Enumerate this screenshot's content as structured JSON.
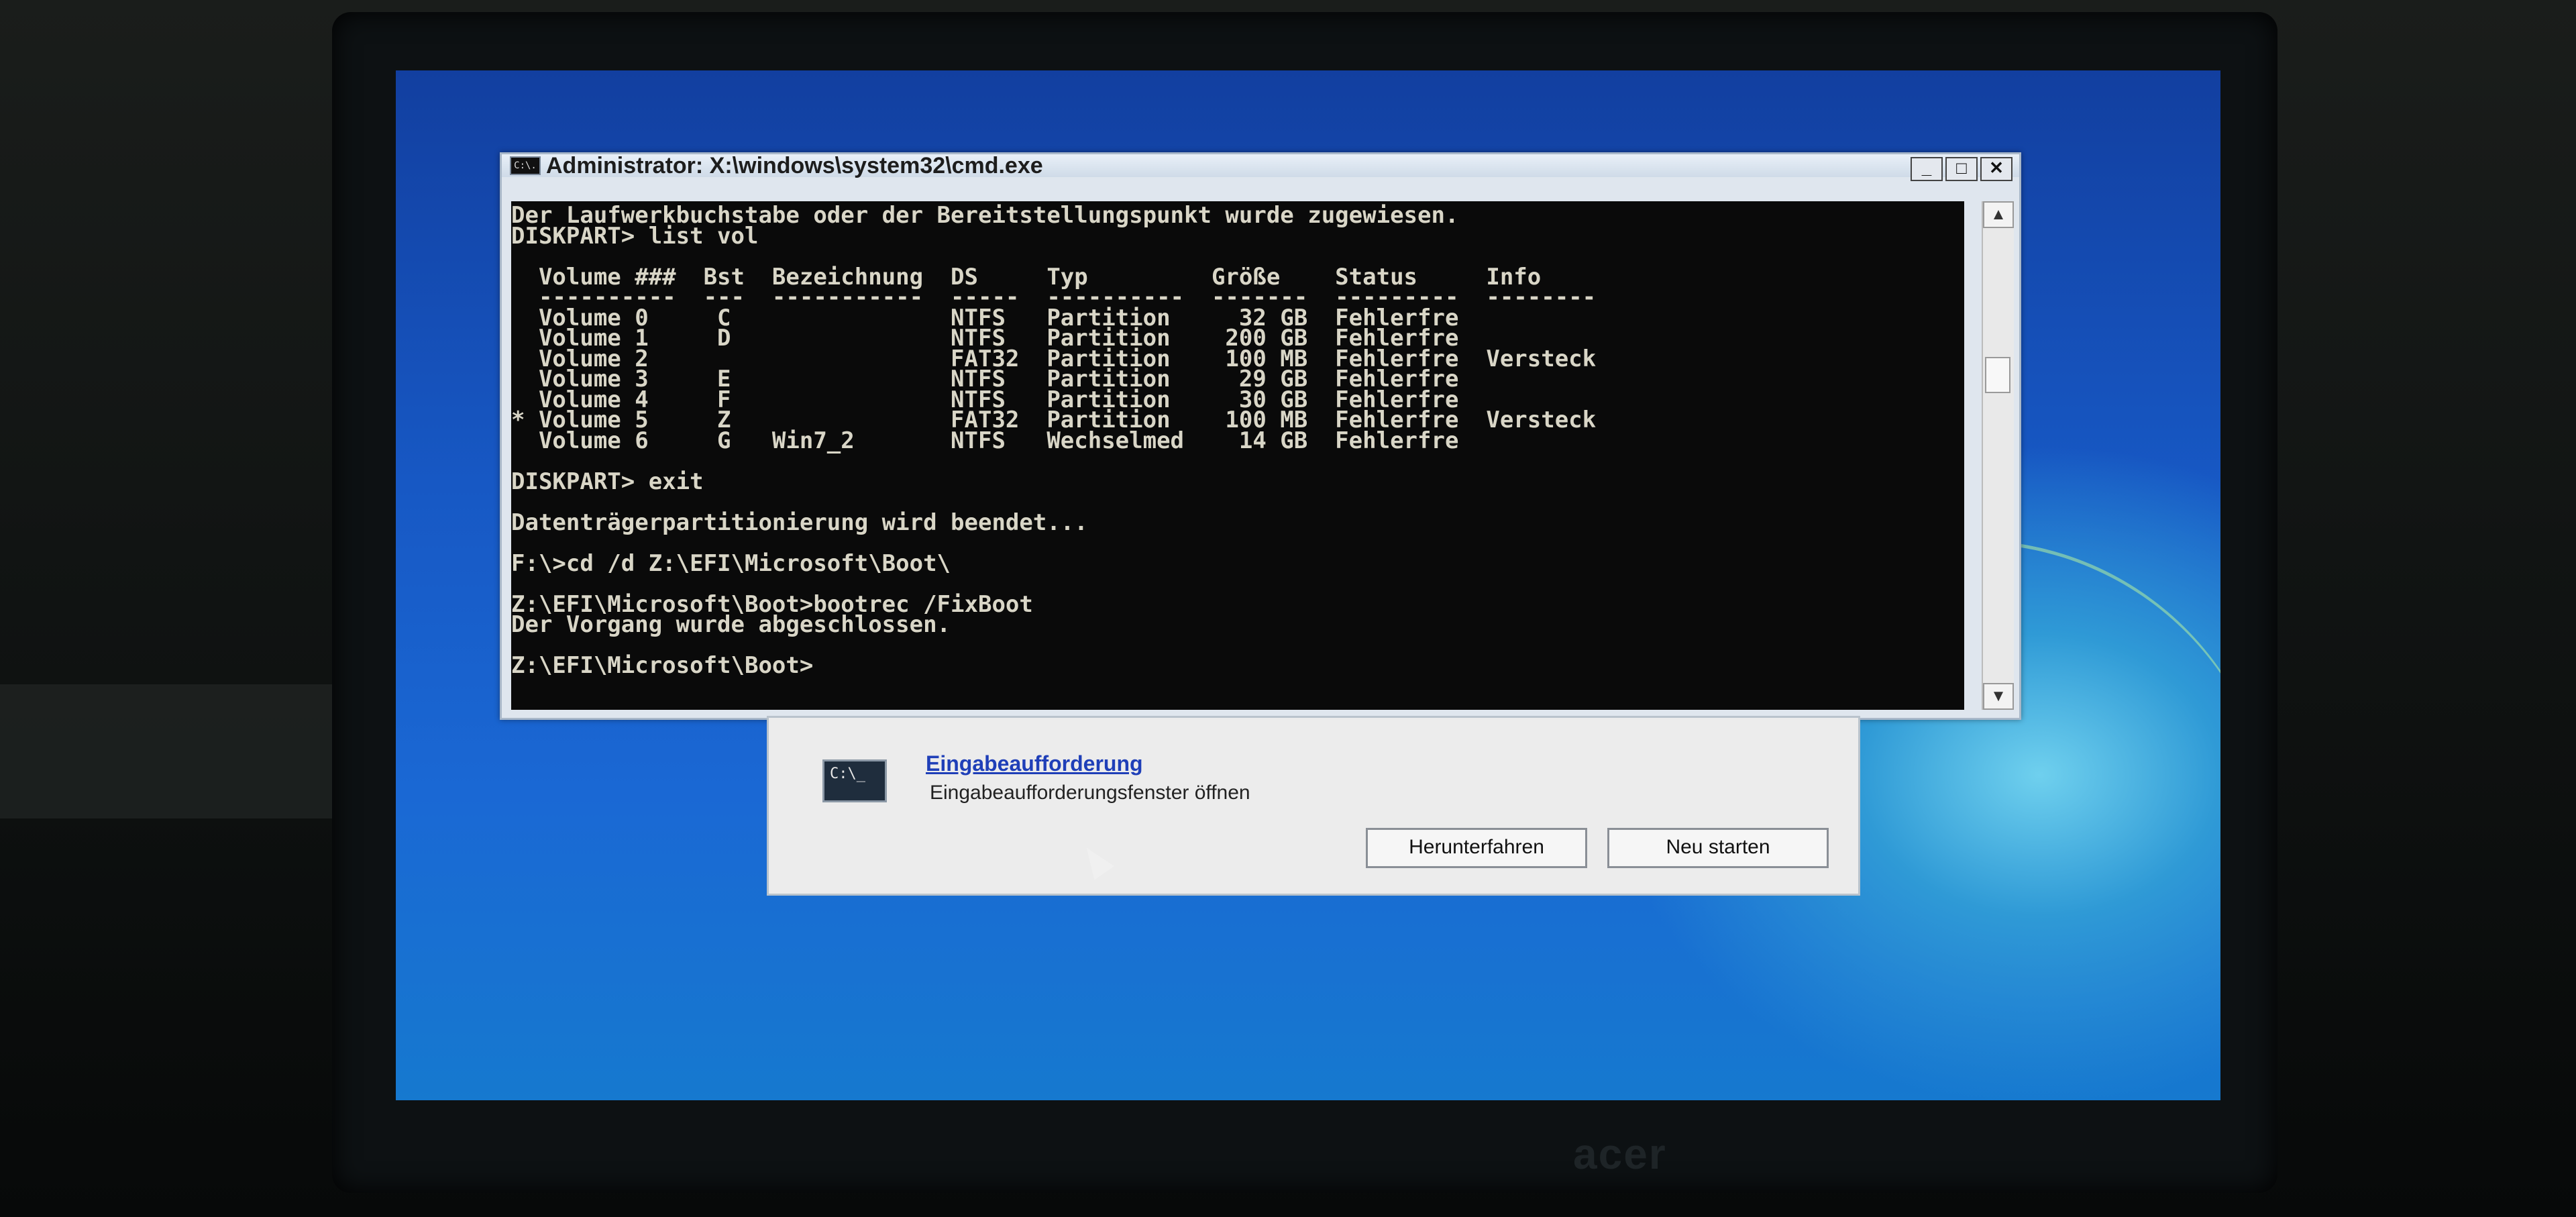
{
  "window": {
    "title": "Administrator: X:\\windows\\system32\\cmd.exe",
    "icon_text": "C:\\.",
    "minimize_glyph": "_",
    "maximize_glyph": "□",
    "close_glyph": "✕"
  },
  "console": {
    "lines": [
      "Der Laufwerkbuchstabe oder der Bereitstellungspunkt wurde zugewiesen.",
      "DISKPART> list vol",
      "",
      "  Volume ###  Bst  Bezeichnung  DS     Typ         Größe    Status     Info",
      "  ----------  ---  -----------  -----  ----------  -------  ---------  --------",
      "  Volume 0     C                NTFS   Partition     32 GB  Fehlerfre",
      "  Volume 1     D                NTFS   Partition    200 GB  Fehlerfre",
      "  Volume 2                      FAT32  Partition    100 MB  Fehlerfre  Versteck",
      "  Volume 3     E                NTFS   Partition     29 GB  Fehlerfre",
      "  Volume 4     F                NTFS   Partition     30 GB  Fehlerfre",
      "* Volume 5     Z                FAT32  Partition    100 MB  Fehlerfre  Versteck",
      "  Volume 6     G   Win7_2       NTFS   Wechselmed    14 GB  Fehlerfre",
      "",
      "DISKPART> exit",
      "",
      "Datenträgerpartitionierung wird beendet...",
      "",
      "F:\\>cd /d Z:\\EFI\\Microsoft\\Boot\\",
      "",
      "Z:\\EFI\\Microsoft\\Boot>bootrec /FixBoot",
      "Der Vorgang wurde abgeschlossen.",
      "",
      "Z:\\EFI\\Microsoft\\Boot>"
    ]
  },
  "recovery_dialog": {
    "option_title": "Eingabeaufforderung",
    "option_description": "Eingabeaufforderungsfenster öffnen",
    "prompt_icon_text": "C:\\_",
    "shutdown_label": "Herunterfahren",
    "restart_label": "Neu starten"
  },
  "monitor": {
    "brand": "acer"
  }
}
